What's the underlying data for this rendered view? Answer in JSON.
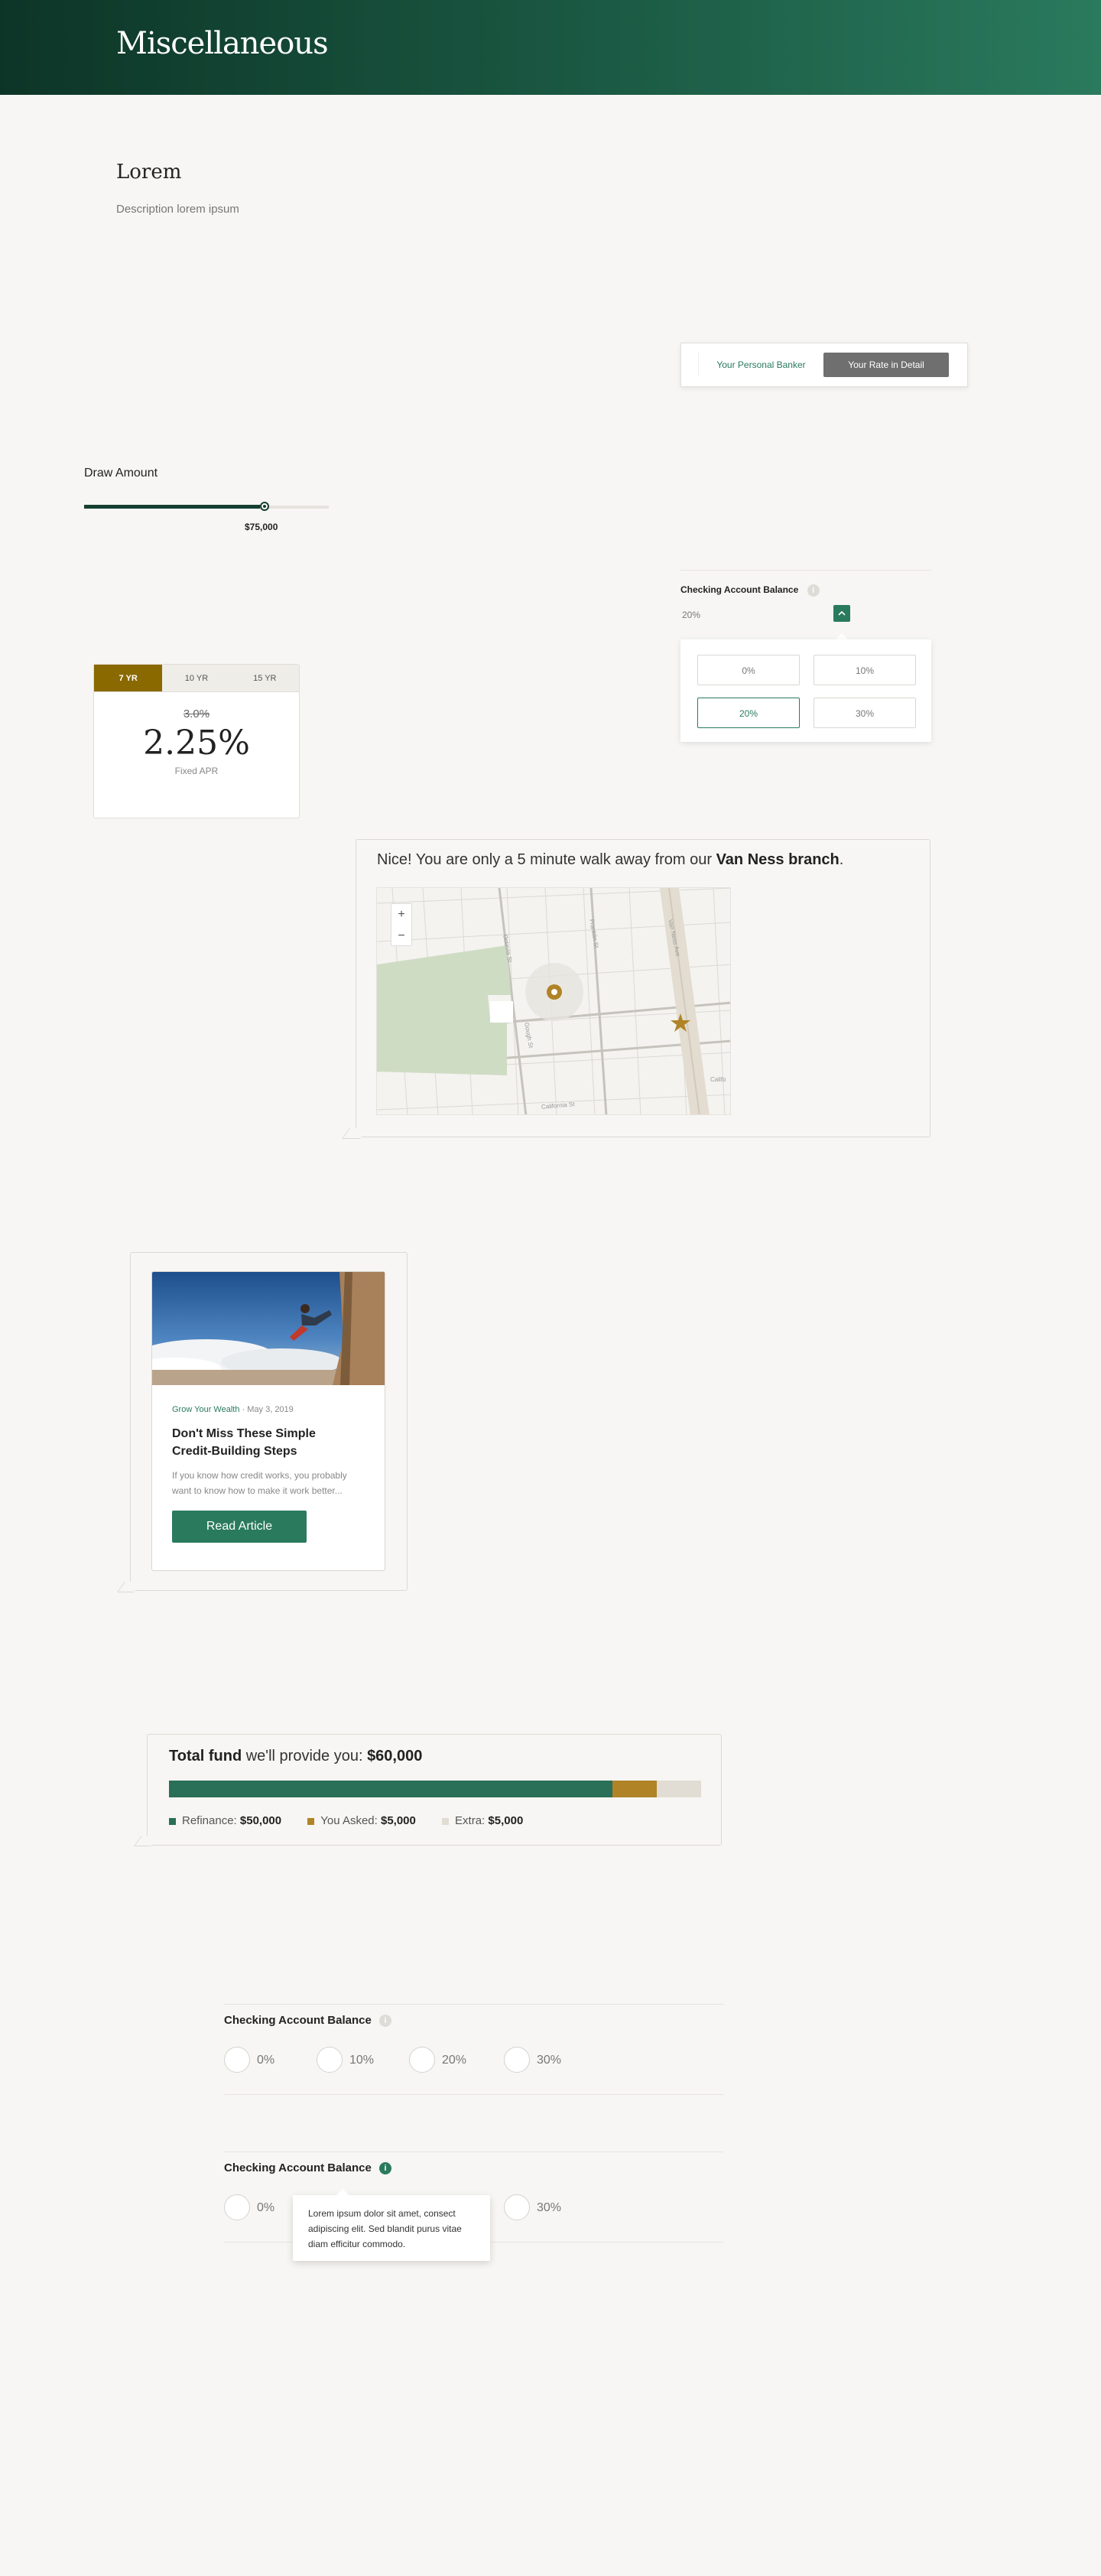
{
  "header": {
    "title": "Miscellaneous"
  },
  "intro": {
    "title": "Lorem",
    "description": "Description lorem ipsum"
  },
  "segmented": {
    "left": "Your Personal Banker",
    "right": "Your Rate in Detail"
  },
  "draw": {
    "label": "Draw Amount",
    "value": "$75,000",
    "fill_fraction": 0.72
  },
  "rate_card": {
    "tabs": [
      "7 YR",
      "10 YR",
      "15 YR"
    ],
    "old_rate": "3.0%",
    "rate": "2.25%",
    "caption": "Fixed APR"
  },
  "checking_dropdown": {
    "label": "Checking Account Balance",
    "info": "i",
    "selected": "20%",
    "options": [
      "0%",
      "10%",
      "20%",
      "30%"
    ]
  },
  "map_bubble": {
    "text_before": "Nice! You are only a 5 minute walk away from our ",
    "branch": "Van Ness branch",
    "text_after": ".",
    "zoom_in": "+",
    "zoom_out": "−",
    "streets": [
      "Franklin St",
      "Gough St",
      "Van Ness Ave",
      "California St",
      "Octavia St",
      "Califo"
    ]
  },
  "article": {
    "category": "Grow Your Wealth",
    "date": "May 3, 2019",
    "title": "Don't Miss These Simple Credit-Building Steps",
    "excerpt": "If you know how credit works, you probably want to know how to make it work better...",
    "button": "Read Article"
  },
  "fund": {
    "title_bold": "Total fund",
    "title_rest": " we'll provide you: ",
    "amount": "$60,000",
    "legend": [
      {
        "label": "Refinance: ",
        "value": "$50,000",
        "color": "#2a6f57"
      },
      {
        "label": "You Asked: ",
        "value": "$5,000",
        "color": "#b08326"
      },
      {
        "label": "Extra: ",
        "value": "$5,000",
        "color": "#e1ddd4"
      }
    ],
    "fractions": [
      0.833,
      0.083,
      0.084
    ]
  },
  "radio_group_1": {
    "label": "Checking Account Balance",
    "options": [
      "0%",
      "10%",
      "20%",
      "30%"
    ]
  },
  "radio_group_2": {
    "label": "Checking Account Balance",
    "options": [
      "0%",
      "30%"
    ],
    "tooltip": "Lorem ipsum dolor sit amet, consect adipiscing elit. Sed blandit purus vitae diam efficitur commodo."
  }
}
